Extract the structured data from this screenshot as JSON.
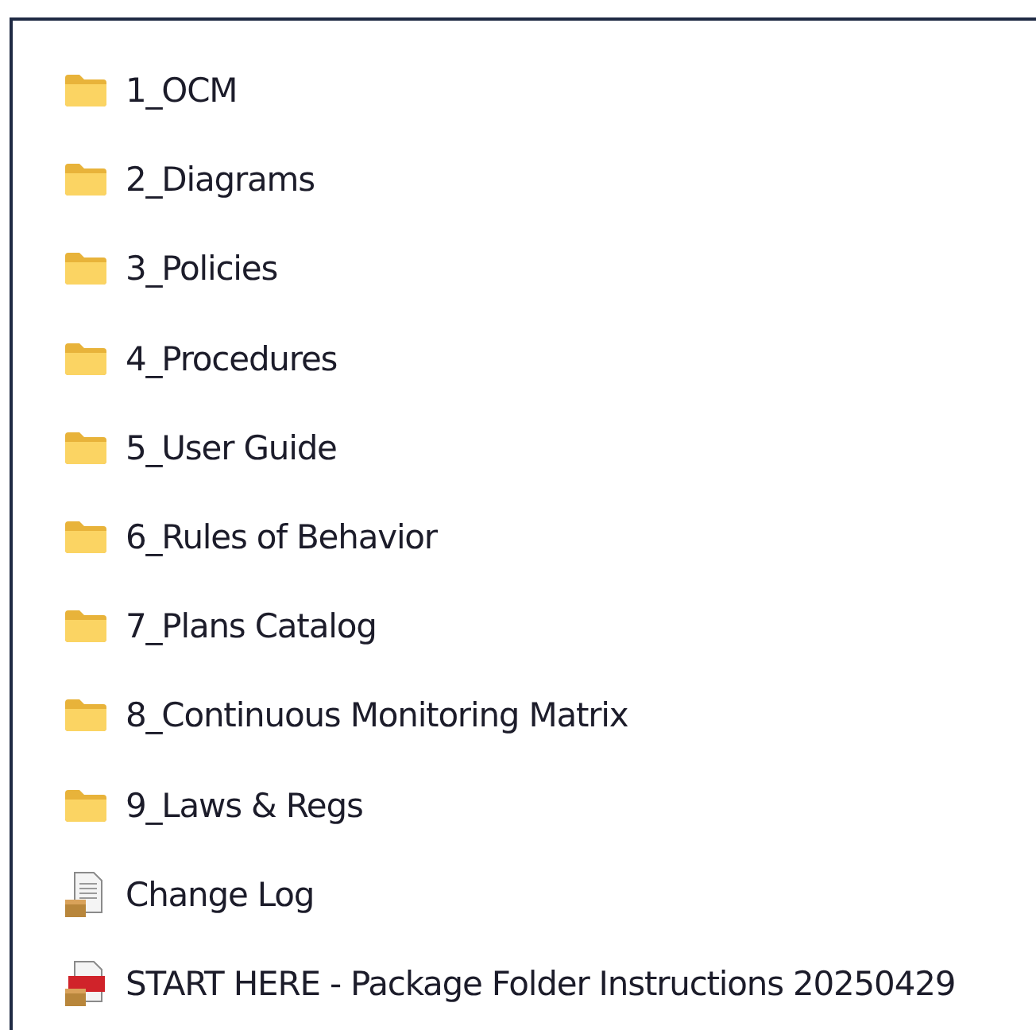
{
  "items": [
    {
      "name": "1_OCM",
      "kind": "folder"
    },
    {
      "name": "2_Diagrams",
      "kind": "folder"
    },
    {
      "name": "3_Policies",
      "kind": "folder"
    },
    {
      "name": "4_Procedures",
      "kind": "folder"
    },
    {
      "name": "5_User Guide",
      "kind": "folder"
    },
    {
      "name": "6_Rules of Behavior",
      "kind": "folder"
    },
    {
      "name": "7_Plans Catalog",
      "kind": "folder"
    },
    {
      "name": "8_Continuous Monitoring Matrix",
      "kind": "folder"
    },
    {
      "name": "9_Laws & Regs",
      "kind": "folder"
    },
    {
      "name": "Change Log",
      "kind": "document"
    },
    {
      "name": "START HERE - Package Folder Instructions 20250429",
      "kind": "pdf"
    }
  ]
}
